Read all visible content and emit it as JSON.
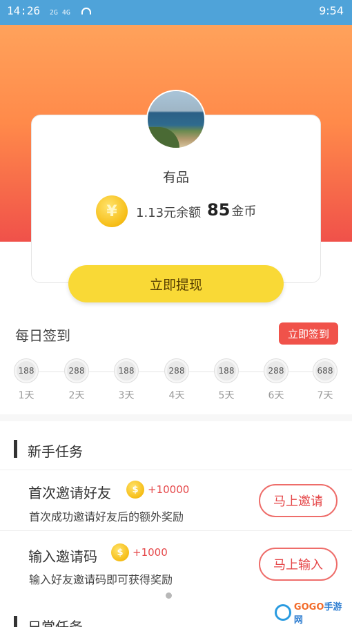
{
  "statusbar": {
    "time_left": "14:26",
    "signal": "2G 4G",
    "time_right": "9:54"
  },
  "profile": {
    "name": "有品",
    "coin_symbol": "¥",
    "balance": "1.13元余额",
    "gold_value": "85",
    "gold_unit": "金币"
  },
  "withdraw_label": "立即提现",
  "daily": {
    "title": "每日签到",
    "button": "立即签到",
    "days": [
      {
        "value": "188",
        "label": "1天"
      },
      {
        "value": "288",
        "label": "2天"
      },
      {
        "value": "188",
        "label": "3天"
      },
      {
        "value": "288",
        "label": "4天"
      },
      {
        "value": "188",
        "label": "5天"
      },
      {
        "value": "288",
        "label": "6天"
      },
      {
        "value": "688",
        "label": "7天"
      }
    ]
  },
  "newbie": {
    "title": "新手任务",
    "tasks": [
      {
        "title": "首次邀请好友",
        "reward": "+10000",
        "desc": "首次成功邀请好友后的额外奖励",
        "button": "马上邀请"
      },
      {
        "title": "输入邀请码",
        "reward": "+1000",
        "desc": "输入好友邀请码即可获得奖励",
        "button": "马上输入"
      }
    ]
  },
  "daily_tasks_title": "日常任务",
  "watermark": {
    "brand_a": "GOGO",
    "brand_b": "手游网"
  },
  "colors": {
    "accent_red": "#f0524a",
    "button_yellow": "#f9d936",
    "status_bar": "#4fa3d9"
  }
}
